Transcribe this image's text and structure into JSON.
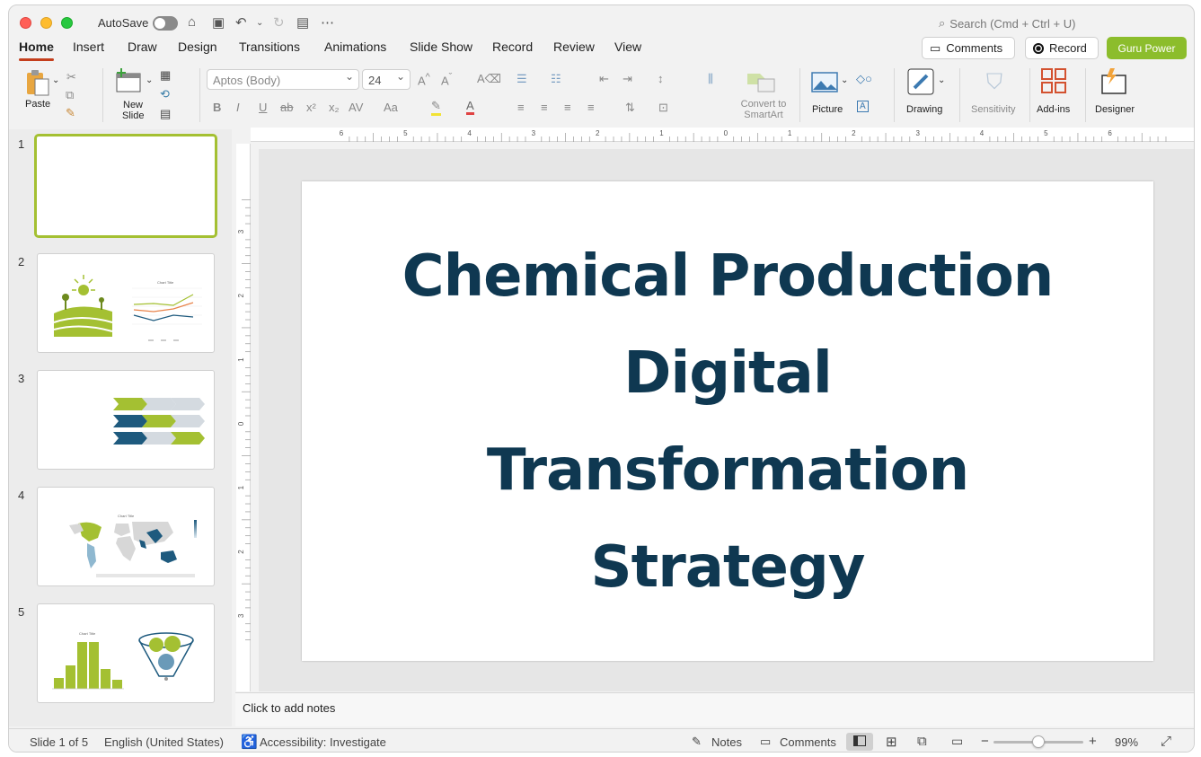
{
  "titlebar": {
    "autosave_label": "AutoSave",
    "search_placeholder": "Search (Cmd + Ctrl + U)"
  },
  "tabs": [
    "Home",
    "Insert",
    "Draw",
    "Design",
    "Transitions",
    "Animations",
    "Slide Show",
    "Record",
    "Review",
    "View"
  ],
  "top_buttons": {
    "comments": "Comments",
    "record": "Record",
    "guru_power": "Guru Power"
  },
  "ribbon": {
    "paste": "Paste",
    "new_slide_1": "New",
    "new_slide_2": "Slide",
    "font_name": "Aptos (Body)",
    "font_size": "24",
    "convert_1": "Convert to",
    "convert_2": "SmartArt",
    "picture": "Picture",
    "drawing": "Drawing",
    "sensitivity": "Sensitivity",
    "addins": "Add-ins",
    "designer": "Designer"
  },
  "ruler_h": [
    "6",
    "5",
    "4",
    "3",
    "2",
    "1",
    "0",
    "1",
    "2",
    "3",
    "4",
    "5",
    "6"
  ],
  "ruler_v": [
    "3",
    "2",
    "1",
    "0",
    "1",
    "2",
    "3"
  ],
  "slides": {
    "numbers": [
      "1",
      "2",
      "3",
      "4",
      "5"
    ],
    "thumb2_chart_title": "Chart Title",
    "thumb4_chart_title": "Chart Title",
    "thumb5_chart_title": "Chart Title"
  },
  "slide": {
    "title_lines": [
      "Chemical Production",
      "Digital",
      "Transformation",
      "Strategy"
    ]
  },
  "notes_placeholder": "Click to add notes",
  "status": {
    "slide_counter": "Slide 1 of 5",
    "language": "English (United States)",
    "accessibility": "Accessibility: Investigate",
    "notes": "Notes",
    "comments": "Comments",
    "zoom": "99%",
    "zoom_level": 0.5
  },
  "colors": {
    "accent": "#c43e1c",
    "title": "#0f3851",
    "green": "#a4c032",
    "navy": "#1e5a7e"
  }
}
